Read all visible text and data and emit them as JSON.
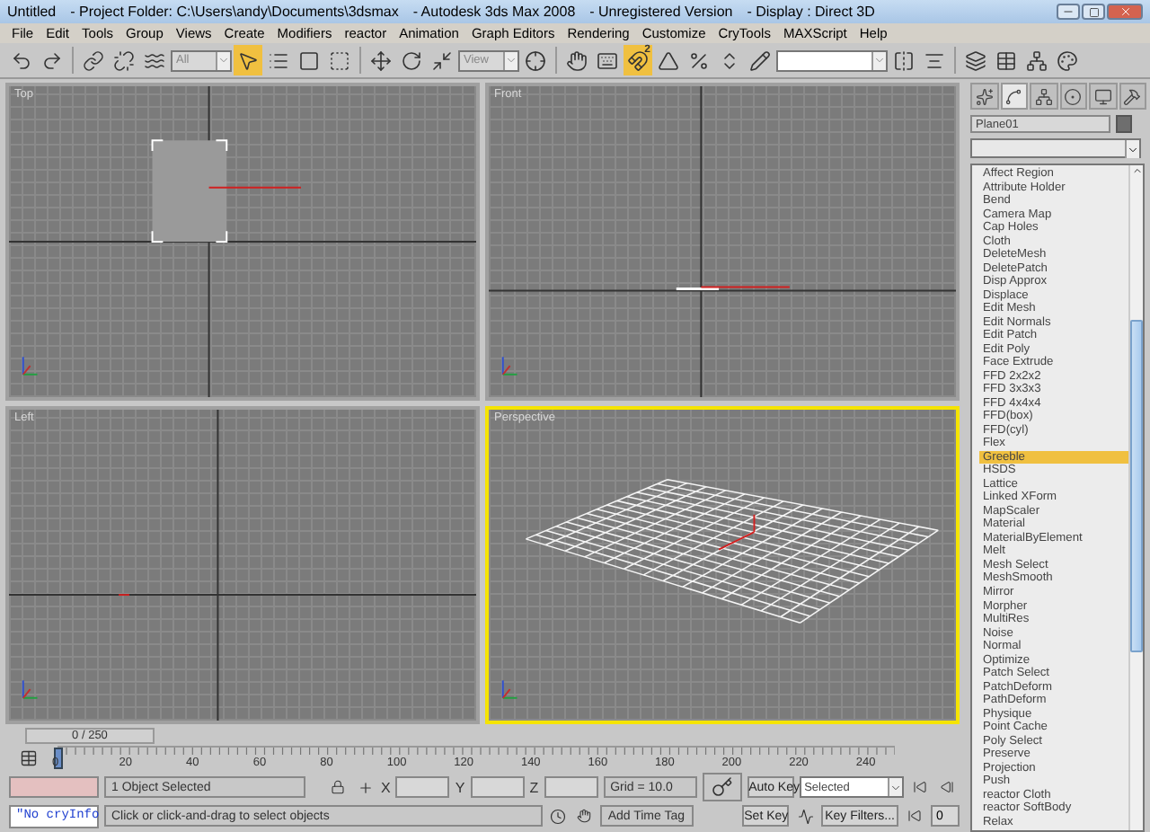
{
  "window": {
    "title_parts": [
      "Untitled",
      "- Project Folder: C:\\Users\\andy\\Documents\\3dsmax",
      "- Autodesk 3ds Max 2008",
      "- Unregistered Version",
      "- Display : Direct 3D"
    ]
  },
  "menu": [
    "File",
    "Edit",
    "Tools",
    "Group",
    "Views",
    "Create",
    "Modifiers",
    "reactor",
    "Animation",
    "Graph Editors",
    "Rendering",
    "Customize",
    "CryTools",
    "MAXScript",
    "Help"
  ],
  "toolbar": [
    {
      "kind": "undo",
      "selected": false
    },
    {
      "kind": "redo",
      "selected": false
    },
    {
      "kind": "sep"
    },
    {
      "kind": "link",
      "selected": false
    },
    {
      "kind": "unlink",
      "selected": false
    },
    {
      "kind": "bind",
      "selected": false
    },
    {
      "kind": "dropdown",
      "value": "All"
    },
    {
      "kind": "select",
      "selected": true
    },
    {
      "kind": "select_by_name",
      "selected": false
    },
    {
      "kind": "region",
      "selected": false
    },
    {
      "kind": "crossing",
      "selected": false
    },
    {
      "kind": "sep"
    },
    {
      "kind": "move",
      "selected": false
    },
    {
      "kind": "rotate",
      "selected": false
    },
    {
      "kind": "scale",
      "selected": false
    },
    {
      "kind": "dropdown",
      "value": "View"
    },
    {
      "kind": "pivot",
      "selected": false
    },
    {
      "kind": "sep"
    },
    {
      "kind": "manipulate",
      "selected": false
    },
    {
      "kind": "keyboard",
      "selected": false
    },
    {
      "kind": "snap",
      "label": "2",
      "selected": true
    },
    {
      "kind": "angle_snap",
      "selected": false
    },
    {
      "kind": "percent_snap",
      "selected": false
    },
    {
      "kind": "spinner_snap",
      "selected": false
    },
    {
      "kind": "named_sets",
      "selected": false
    },
    {
      "kind": "dropdown_wide"
    },
    {
      "kind": "mirror",
      "selected": false
    },
    {
      "kind": "align",
      "selected": false
    },
    {
      "kind": "sep"
    },
    {
      "kind": "layers",
      "selected": false
    },
    {
      "kind": "curve_editor",
      "selected": false
    },
    {
      "kind": "schematic",
      "selected": false
    },
    {
      "kind": "material",
      "selected": false
    }
  ],
  "viewports": [
    {
      "label": "Top",
      "kind": "top",
      "active": false
    },
    {
      "label": "Front",
      "kind": "front",
      "active": false
    },
    {
      "label": "Left",
      "kind": "left",
      "active": false
    },
    {
      "label": "Perspective",
      "kind": "perspective",
      "active": true
    }
  ],
  "command_panel": {
    "tabs": [
      {
        "kind": "create",
        "selected": false
      },
      {
        "kind": "modify",
        "selected": true
      },
      {
        "kind": "hierarchy",
        "selected": false
      },
      {
        "kind": "motion",
        "selected": false
      },
      {
        "kind": "display",
        "selected": false
      },
      {
        "kind": "utilities",
        "selected": false
      }
    ],
    "object_name": "Plane01",
    "color": "#6e6e6e",
    "modifier_list": [
      {
        "label": "Affect Region",
        "selected": false
      },
      {
        "label": "Attribute Holder",
        "selected": false
      },
      {
        "label": "Bend",
        "selected": false
      },
      {
        "label": "Camera Map",
        "selected": false
      },
      {
        "label": "Cap Holes",
        "selected": false
      },
      {
        "label": "Cloth",
        "selected": false
      },
      {
        "label": "DeleteMesh",
        "selected": false
      },
      {
        "label": "DeletePatch",
        "selected": false
      },
      {
        "label": "Disp Approx",
        "selected": false
      },
      {
        "label": "Displace",
        "selected": false
      },
      {
        "label": "Edit Mesh",
        "selected": false
      },
      {
        "label": "Edit Normals",
        "selected": false
      },
      {
        "label": "Edit Patch",
        "selected": false
      },
      {
        "label": "Edit Poly",
        "selected": false
      },
      {
        "label": "Face Extrude",
        "selected": false
      },
      {
        "label": "FFD 2x2x2",
        "selected": false
      },
      {
        "label": "FFD 3x3x3",
        "selected": false
      },
      {
        "label": "FFD 4x4x4",
        "selected": false
      },
      {
        "label": "FFD(box)",
        "selected": false
      },
      {
        "label": "FFD(cyl)",
        "selected": false
      },
      {
        "label": "Flex",
        "selected": false
      },
      {
        "label": "Greeble",
        "selected": true
      },
      {
        "label": "HSDS",
        "selected": false
      },
      {
        "label": "Lattice",
        "selected": false
      },
      {
        "label": "Linked XForm",
        "selected": false
      },
      {
        "label": "MapScaler",
        "selected": false
      },
      {
        "label": "Material",
        "selected": false
      },
      {
        "label": "MaterialByElement",
        "selected": false
      },
      {
        "label": "Melt",
        "selected": false
      },
      {
        "label": "Mesh Select",
        "selected": false
      },
      {
        "label": "MeshSmooth",
        "selected": false
      },
      {
        "label": "Mirror",
        "selected": false
      },
      {
        "label": "Morpher",
        "selected": false
      },
      {
        "label": "MultiRes",
        "selected": false
      },
      {
        "label": "Noise",
        "selected": false
      },
      {
        "label": "Normal",
        "selected": false
      },
      {
        "label": "Optimize",
        "selected": false
      },
      {
        "label": "Patch Select",
        "selected": false
      },
      {
        "label": "PatchDeform",
        "selected": false
      },
      {
        "label": "PathDeform",
        "selected": false
      },
      {
        "label": "Physique",
        "selected": false
      },
      {
        "label": "Point Cache",
        "selected": false
      },
      {
        "label": "Poly Select",
        "selected": false
      },
      {
        "label": "Preserve",
        "selected": false
      },
      {
        "label": "Projection",
        "selected": false
      },
      {
        "label": "Push",
        "selected": false
      },
      {
        "label": "reactor Cloth",
        "selected": false
      },
      {
        "label": "reactor SoftBody",
        "selected": false
      },
      {
        "label": "Relax",
        "selected": false
      }
    ]
  },
  "timeline": {
    "slider": "0 / 250",
    "level": 0,
    "ticks": [
      "0",
      "20",
      "40",
      "60",
      "80",
      "100",
      "120",
      "140",
      "160",
      "180",
      "200",
      "220",
      "240"
    ]
  },
  "status_bar": {
    "info": "\"No cryInfo",
    "selection": "1 Object Selected",
    "prompt": "Click or click-and-drag to select objects",
    "x_label": "X",
    "y_label": "Y",
    "z_label": "Z",
    "grid": "Grid = 10.0",
    "time_tag": "Add Time Tag",
    "auto_key": "Auto Key",
    "set_key": "Set Key",
    "key_mode": "Selected",
    "key_filters": "Key Filters...",
    "frame": "0"
  }
}
